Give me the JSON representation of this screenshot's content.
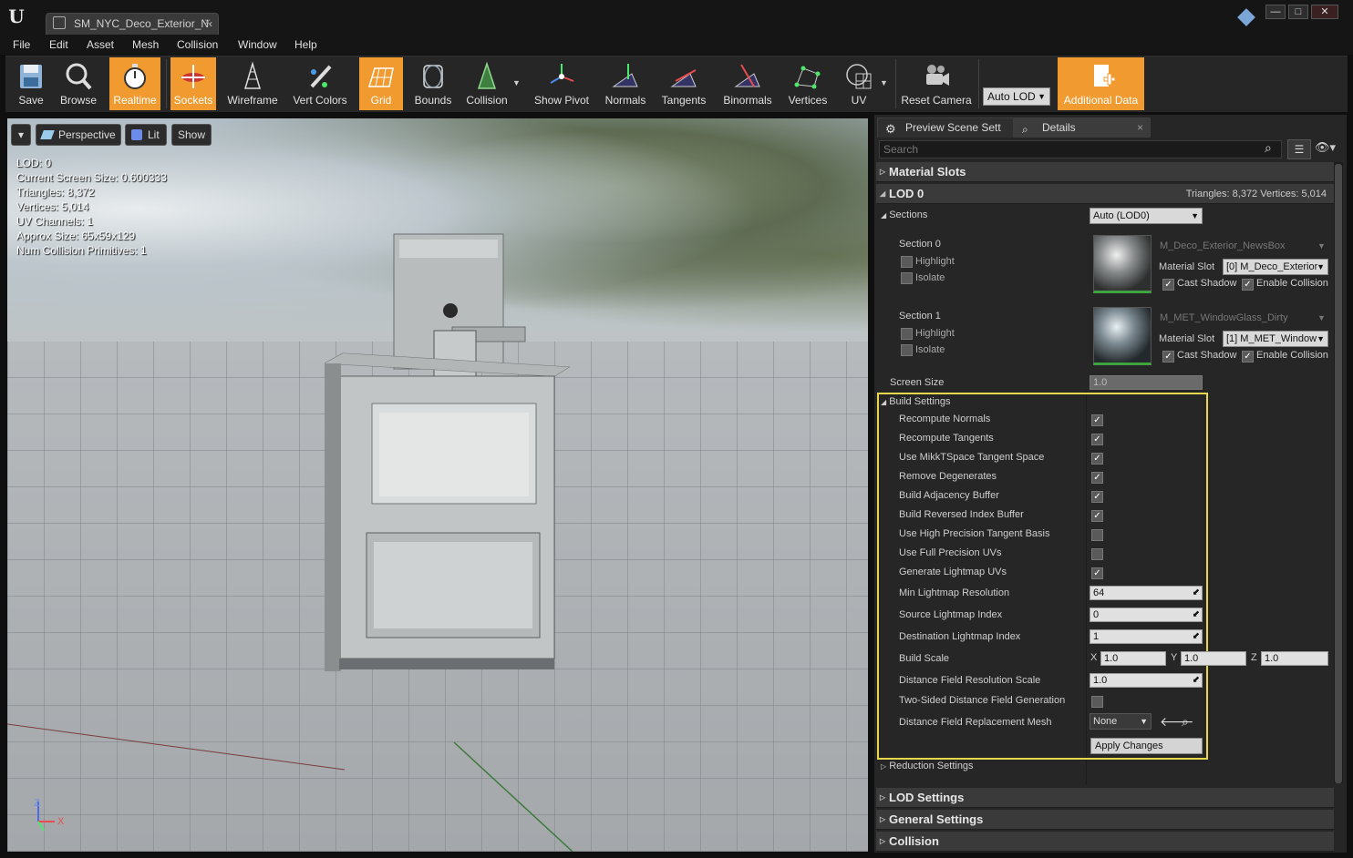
{
  "window": {
    "tab_title": "SM_NYC_Deco_Exterior_N‹",
    "min_label": "—",
    "max_label": "□",
    "close_label": "✕",
    "tab_close": "×"
  },
  "menu": [
    "File",
    "Edit",
    "Asset",
    "Mesh",
    "Collision",
    "Window",
    "Help"
  ],
  "toolbar": {
    "items": [
      "Save",
      "Browse",
      "Realtime",
      "Sockets",
      "Wireframe",
      "Vert Colors",
      "Grid",
      "Bounds",
      "Collision",
      "Show Pivot",
      "Normals",
      "Tangents",
      "Binormals",
      "Vertices",
      "UV",
      "Reset Camera"
    ],
    "auto_lod": "Auto LOD",
    "additional_data": "Additional Data",
    "active_color": "#f19a2f"
  },
  "viewport": {
    "perspective": "Perspective",
    "lit": "Lit",
    "show": "Show",
    "stats": [
      "LOD:  0",
      "Current Screen Size:  0.600333",
      "Triangles:  8,372",
      "Vertices:  5,014",
      "UV Channels:  1",
      "Approx Size: 65x59x129",
      "Num Collision Primitives:  1"
    ],
    "axis_x": "X",
    "axis_z": "Z"
  },
  "panel": {
    "tabs": [
      "Preview Scene Sett",
      "Details"
    ],
    "search_placeholder": "Search",
    "material_slots": "Material Slots",
    "lod0": "LOD 0",
    "lod0_stats": "Triangles: 8,372    Vertices: 5,014",
    "sections_label": "Sections",
    "sections_dropdown": "Auto (LOD0)",
    "section0": {
      "title": "Section 0",
      "highlight": "Highlight",
      "isolate": "Isolate",
      "material": "M_Deco_Exterior_NewsBox",
      "slot_label": "Material Slot",
      "slot_value": "[0] M_Deco_Exterior",
      "cast_shadow": "Cast Shadow",
      "enable_collision": "Enable Collision"
    },
    "section1": {
      "title": "Section 1",
      "highlight": "Highlight",
      "isolate": "Isolate",
      "material": "M_MET_WindowGlass_Dirty",
      "slot_label": "Material Slot",
      "slot_value": "[1] M_MET_Window",
      "cast_shadow": "Cast Shadow",
      "enable_collision": "Enable Collision"
    },
    "screen_size_label": "Screen Size",
    "screen_size_value": "1.0",
    "build_settings": {
      "title": "Build Settings",
      "checks": [
        {
          "label": "Recompute Normals",
          "checked": true
        },
        {
          "label": "Recompute Tangents",
          "checked": true
        },
        {
          "label": "Use MikkTSpace Tangent Space",
          "checked": true
        },
        {
          "label": "Remove Degenerates",
          "checked": true
        },
        {
          "label": "Build Adjacency Buffer",
          "checked": true
        },
        {
          "label": "Build Reversed Index Buffer",
          "checked": true
        },
        {
          "label": "Use High Precision Tangent Basis",
          "checked": false
        },
        {
          "label": "Use Full Precision UVs",
          "checked": false
        },
        {
          "label": "Generate Lightmap UVs",
          "checked": true
        }
      ],
      "min_lightmap_label": "Min Lightmap Resolution",
      "min_lightmap_value": "64",
      "source_lightmap_label": "Source Lightmap Index",
      "source_lightmap_value": "0",
      "dest_lightmap_label": "Destination Lightmap Index",
      "dest_lightmap_value": "1",
      "build_scale_label": "Build Scale",
      "build_scale": {
        "x_label": "X",
        "x": "1.0",
        "y_label": "Y",
        "y": "1.0",
        "z_label": "Z",
        "z": "1.0"
      },
      "df_res_label": "Distance Field Resolution Scale",
      "df_res_value": "1.0",
      "two_sided_label": "Two-Sided Distance Field Generation",
      "df_mesh_label": "Distance Field Replacement Mesh",
      "df_mesh_value": "None",
      "apply": "Apply Changes"
    },
    "reduction_settings": "Reduction Settings",
    "lod_settings": "LOD Settings",
    "general_settings": "General Settings",
    "collision": "Collision",
    "highlight_color": "#e6d84a"
  }
}
